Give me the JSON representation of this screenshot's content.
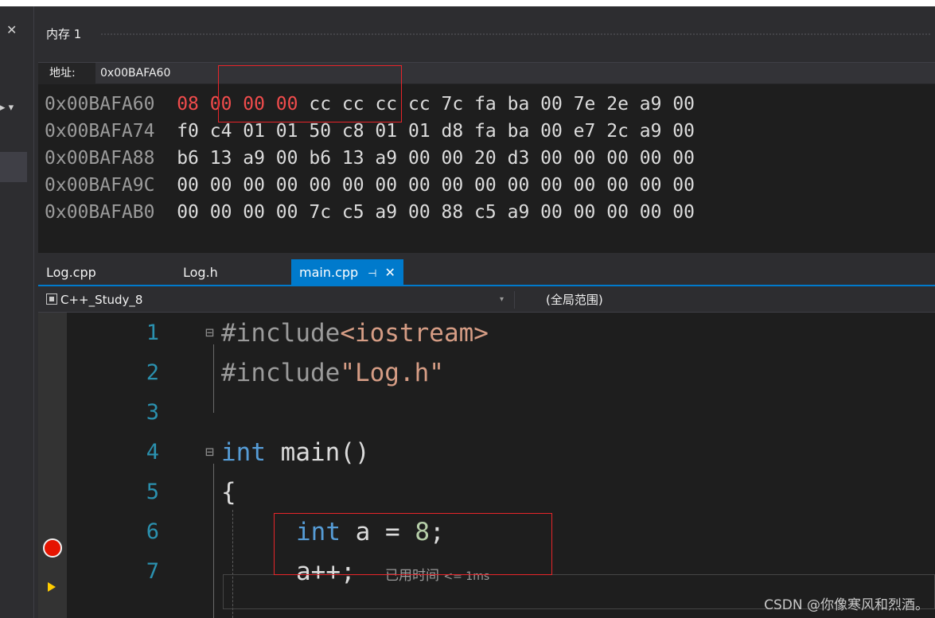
{
  "memory_window": {
    "title": "内存 1",
    "address_label": "地址:",
    "address_value": "0x00BAFA60",
    "rows": [
      {
        "address": "0x00BAFA60",
        "highlight": "08 00 00 00",
        "bytes": "cc cc cc cc 7c fa ba 00 7e 2e a9 00"
      },
      {
        "address": "0x00BAFA74",
        "highlight": "",
        "bytes": "f0 c4 01 01 50 c8 01 01 d8 fa ba 00 e7 2c a9 00"
      },
      {
        "address": "0x00BAFA88",
        "highlight": "",
        "bytes": "b6 13 a9 00 b6 13 a9 00 00 20 d3 00 00 00 00 00"
      },
      {
        "address": "0x00BAFA9C",
        "highlight": "",
        "bytes": "00 00 00 00 00 00 00 00 00 00 00 00 00 00 00 00"
      },
      {
        "address": "0x00BAFAB0",
        "highlight": "",
        "bytes": "00 00 00 00 7c c5 a9 00 88 c5 a9 00 00 00 00 00"
      }
    ]
  },
  "tabs": [
    {
      "label": "Log.cpp"
    },
    {
      "label": "Log.h"
    },
    {
      "label": "main.cpp",
      "pin": "⊣",
      "close": "✕"
    }
  ],
  "nav": {
    "project": "C++_Study_8",
    "scope": "(全局范围)"
  },
  "code": {
    "line_numbers": [
      "1",
      "2",
      "3",
      "4",
      "5",
      "6",
      "7"
    ],
    "line1": {
      "directive": "#include",
      "header": "<iostream>"
    },
    "line2": {
      "directive": "#include",
      "header": "\"Log.h\""
    },
    "line4": {
      "type": "int",
      "name": " main()"
    },
    "line5": {
      "text": "{"
    },
    "line6": {
      "type": "int",
      "rest": " a = ",
      "value": "8",
      "end": ";"
    },
    "line7": {
      "text": "a++;",
      "perf_label": "已用时间",
      "perf_value": "<= 1ms"
    }
  },
  "watermark": "CSDN @你像寒风和烈酒。",
  "colors": {
    "breakpoint": "#e51400",
    "highlight_box": "#e8252a",
    "accent": "#007acc",
    "line_number": "#2b91af"
  }
}
